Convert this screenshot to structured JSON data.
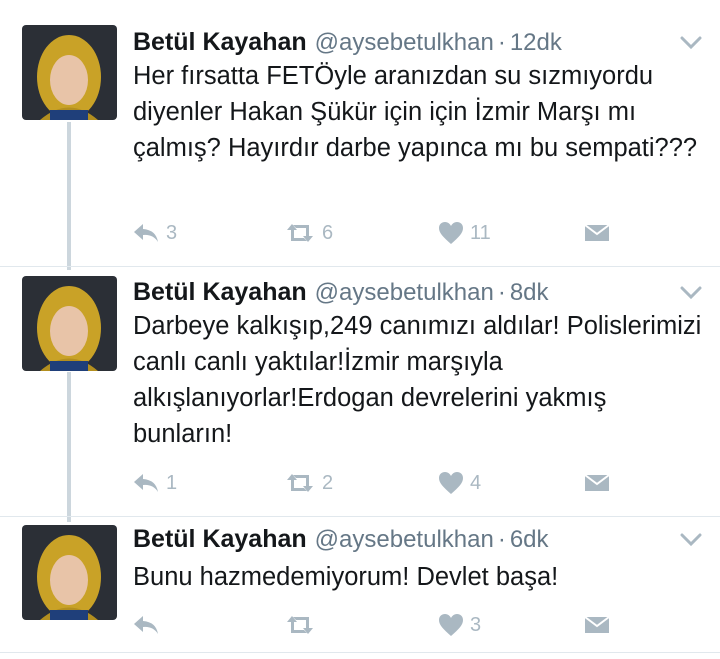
{
  "tweets": [
    {
      "name": "Betül Kayahan",
      "handle": "@aysebetulkhan",
      "sep": "·",
      "time": "12dk",
      "text": "Her fırsatta FETÖyle aranızdan su sızmıyordu diyenler Hakan Şükür için için İzmir Marşı mı çalmış? Hayırdır darbe yapınca mı bu sempati???",
      "replies": "3",
      "retweets": "6",
      "likes": "11"
    },
    {
      "name": "Betül Kayahan",
      "handle": "@aysebetulkhan",
      "sep": "·",
      "time": "8dk",
      "text": "Darbeye kalkışıp,249 canımızı aldılar! Polislerimizi canlı canlı yaktılar!İzmir marşıyla alkışlanıyorlar!Erdogan devrelerini yakmış bunların!",
      "replies": "1",
      "retweets": "2",
      "likes": "4"
    },
    {
      "name": "Betül Kayahan",
      "handle": "@aysebetulkhan",
      "sep": "·",
      "time": "6dk",
      "text": "Bunu hazmedemiyorum! Devlet başa!",
      "replies": "",
      "retweets": "",
      "likes": "3"
    }
  ],
  "icons": {
    "reply": "reply-icon",
    "retweet": "retweet-icon",
    "like": "heart-icon",
    "dm": "envelope-icon",
    "more": "chevron-down-icon"
  },
  "colors": {
    "icon_gray": "#aab8c2",
    "text": "#14171a",
    "meta": "#657786",
    "divider": "#e1e8ed",
    "thread_line": "#ccd6dd"
  }
}
